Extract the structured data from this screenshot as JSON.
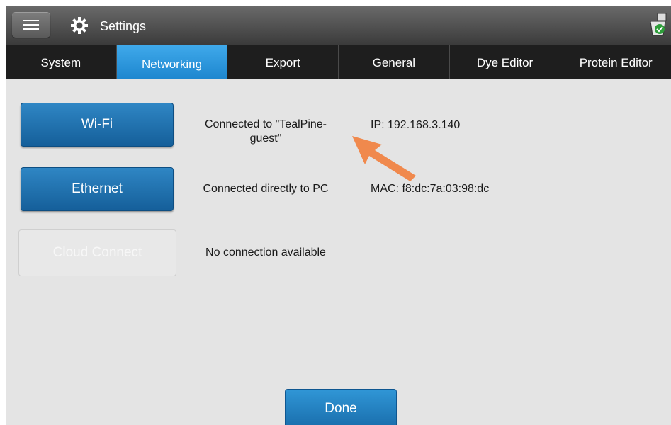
{
  "header": {
    "title": "Settings",
    "menu_icon": "hamburger-menu-icon",
    "settings_icon": "gear-icon",
    "status_icon": "clipboard-check-icon"
  },
  "tabs": [
    {
      "label": "System",
      "active": false
    },
    {
      "label": "Networking",
      "active": true
    },
    {
      "label": "Export",
      "active": false
    },
    {
      "label": "General",
      "active": false
    },
    {
      "label": "Dye Editor",
      "active": false
    },
    {
      "label": "Protein Editor",
      "active": false
    }
  ],
  "networking": {
    "wifi": {
      "button_label": "Wi-Fi",
      "status_line1": "Connected to \"TealPine-",
      "status_line2": "guest\"",
      "info": "IP: 192.168.3.140"
    },
    "ethernet": {
      "button_label": "Ethernet",
      "status": "Connected directly to PC",
      "info": "MAC: f8:dc:7a:03:98:dc"
    },
    "cloud": {
      "button_label": "Cloud Connect",
      "enabled": false,
      "status": "No connection available"
    }
  },
  "footer": {
    "done_label": "Done"
  },
  "colors": {
    "accent_blue": "#1d86cf",
    "annotation_arrow": "#f0894d"
  }
}
